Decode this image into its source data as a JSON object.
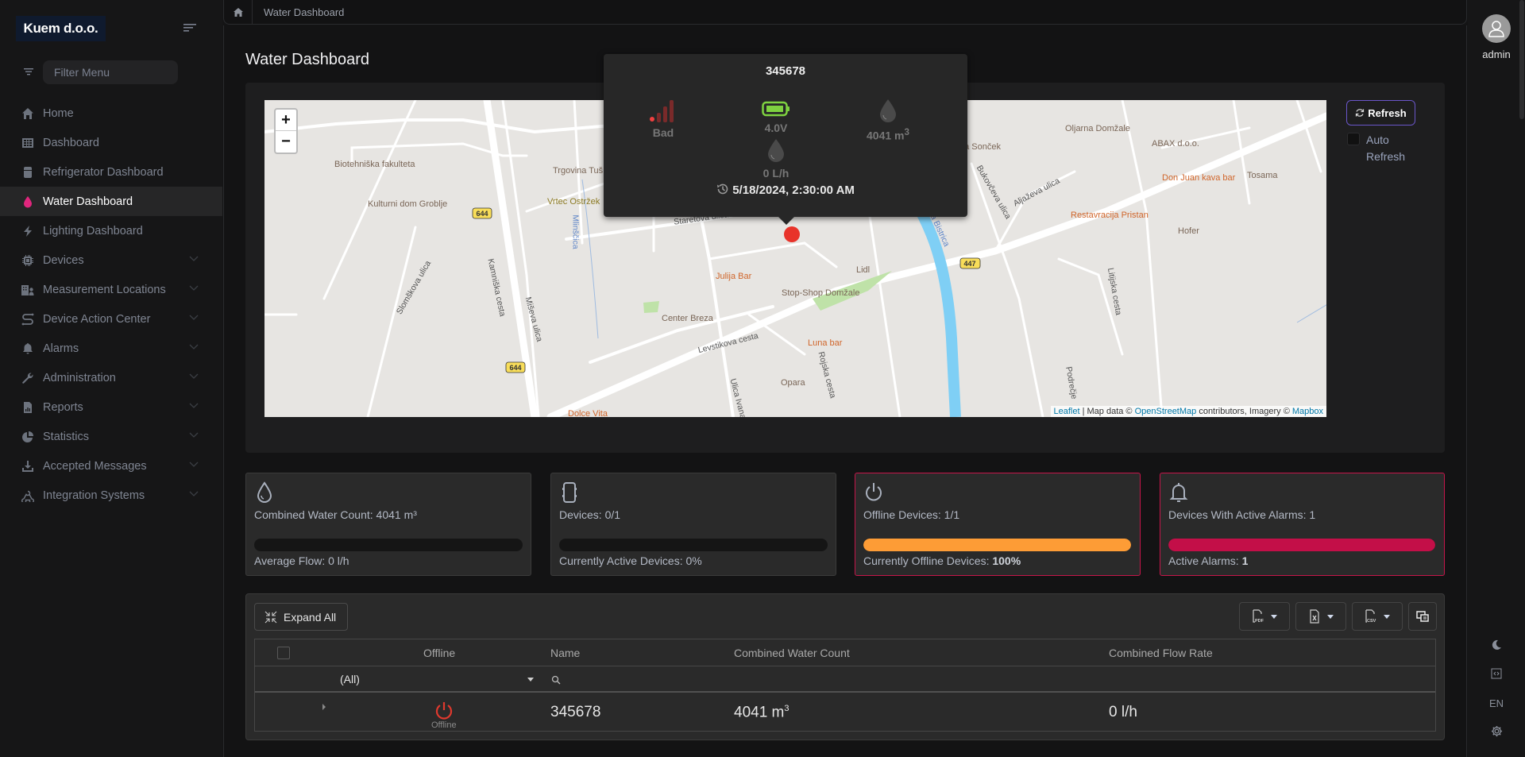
{
  "sidebar": {
    "brand": "Kuem d.o.o.",
    "filter_placeholder": "Filter Menu",
    "items": [
      {
        "label": "Home",
        "icon": "home-icon",
        "active": false,
        "expandable": false
      },
      {
        "label": "Dashboard",
        "icon": "grid-icon",
        "active": false,
        "expandable": false
      },
      {
        "label": "Refrigerator Dashboard",
        "icon": "refrigerator-icon",
        "active": false,
        "expandable": false
      },
      {
        "label": "Water Dashboard",
        "icon": "water-drop-icon",
        "active": true,
        "expandable": false
      },
      {
        "label": "Lighting Dashboard",
        "icon": "lightning-icon",
        "active": false,
        "expandable": false
      },
      {
        "label": "Devices",
        "icon": "chip-icon",
        "active": false,
        "expandable": true
      },
      {
        "label": "Measurement Locations",
        "icon": "building-user-icon",
        "active": false,
        "expandable": true
      },
      {
        "label": "Device Action Center",
        "icon": "route-icon",
        "active": false,
        "expandable": true
      },
      {
        "label": "Alarms",
        "icon": "bell-icon",
        "active": false,
        "expandable": true
      },
      {
        "label": "Administration",
        "icon": "wrench-icon",
        "active": false,
        "expandable": true
      },
      {
        "label": "Reports",
        "icon": "report-file-icon",
        "active": false,
        "expandable": true
      },
      {
        "label": "Statistics",
        "icon": "pie-chart-icon",
        "active": false,
        "expandable": true
      },
      {
        "label": "Accepted Messages",
        "icon": "download-tray-icon",
        "active": false,
        "expandable": true
      },
      {
        "label": "Integration Systems",
        "icon": "webhook-icon",
        "active": false,
        "expandable": true
      }
    ]
  },
  "breadcrumb": {
    "current": "Water Dashboard"
  },
  "page": {
    "title": "Water Dashboard"
  },
  "map": {
    "zoom_in": "+",
    "zoom_out": "−",
    "attribution": {
      "leaflet": "Leaflet",
      "sep": " | Map data © ",
      "osm": "OpenStreetMap",
      "mid": " contributors, Imagery © ",
      "mapbox": "Mapbox"
    },
    "labels": [
      {
        "text": "Biotehniška fakulteta",
        "kind": "poi"
      },
      {
        "text": "Kulturni dom Groblje",
        "kind": "poi"
      },
      {
        "text": "Trgovina Tuš",
        "kind": "poi"
      },
      {
        "text": "Vrtec Ostržek",
        "kind": "olive"
      },
      {
        "text": "Mlinščica",
        "kind": "water"
      },
      {
        "text": "Staretova ulica",
        "kind": "street"
      },
      {
        "text": "Julija Bar",
        "kind": "orange"
      },
      {
        "text": "Lidl",
        "kind": "poi"
      },
      {
        "text": "Stop-Shop Domžale",
        "kind": "poi"
      },
      {
        "text": "Center Breza",
        "kind": "poi"
      },
      {
        "text": "Luna bar",
        "kind": "orange"
      },
      {
        "text": "Levstikova cesta",
        "kind": "street"
      },
      {
        "text": "Opara",
        "kind": "poi"
      },
      {
        "text": "Dolce Vita",
        "kind": "orange"
      },
      {
        "text": "Kamniška cesta",
        "kind": "street"
      },
      {
        "text": "Miševa ulica",
        "kind": "street"
      },
      {
        "text": "Slomškova ulica",
        "kind": "street"
      },
      {
        "text": "Oljarna Domžale",
        "kind": "poi"
      },
      {
        "text": "ABAX d.o.o.",
        "kind": "poi"
      },
      {
        "text": "Don Juan kava bar",
        "kind": "orange"
      },
      {
        "text": "Tosama",
        "kind": "poi"
      },
      {
        "text": "Restavracija Pristan",
        "kind": "orange"
      },
      {
        "text": "Hofer",
        "kind": "poi"
      },
      {
        "text": "Aljaževa ulica",
        "kind": "street"
      },
      {
        "text": "Bukovčeva ulica",
        "kind": "street"
      },
      {
        "text": "Litijska cesta",
        "kind": "street"
      },
      {
        "text": "Rojska cesta",
        "kind": "street"
      },
      {
        "text": "Ulica Ivana",
        "kind": "street"
      },
      {
        "text": "Podrečje",
        "kind": "street"
      },
      {
        "text": "na Sonček",
        "kind": "poi"
      },
      {
        "text": "Kamniška Bistrica",
        "kind": "water"
      }
    ],
    "road_badges": [
      "644",
      "644",
      "447"
    ]
  },
  "popup": {
    "title": "345678",
    "signal_label": "Bad",
    "battery_label": "4.0V",
    "water_count": "4041 m",
    "water_count_sup": "3",
    "flow": "0 L/h",
    "timestamp": "5/18/2024, 2:30:00 AM"
  },
  "controls": {
    "refresh_label": "Refresh",
    "auto_refresh_label": "Auto Refresh",
    "auto_refresh_checked": false
  },
  "cards": [
    {
      "title": "Combined Water Count: 4041 m³",
      "sub_label": "Average Flow: ",
      "sub_value": "0 l/h",
      "progress_percent": 0,
      "color": "#151515",
      "icon": "water-drop-outline-icon",
      "alert": false
    },
    {
      "title": "Devices: 0/1",
      "sub_label": "Currently Active Devices: ",
      "sub_value": "0%",
      "progress_percent": 0,
      "color": "#151515",
      "icon": "device-icon",
      "alert": false
    },
    {
      "title": "Offline Devices: 1/1",
      "sub_label": "Currently Offline Devices: ",
      "sub_value": "100%",
      "progress_percent": 100,
      "color": "#fd9c36",
      "icon": "power-icon",
      "alert": true
    },
    {
      "title": "Devices With Active Alarms: 1",
      "sub_label": "Active Alarms: ",
      "sub_value": "1",
      "progress_percent": 100,
      "color": "#c30f48",
      "icon": "bell-outline-icon",
      "alert": true
    }
  ],
  "table": {
    "expand_all_label": "Expand All",
    "export_buttons": [
      "PDF",
      "XLSX",
      "CSV"
    ],
    "columns": [
      "Offline",
      "Name",
      "Combined Water Count",
      "Combined Flow Rate"
    ],
    "filter": {
      "offline_value": "(All)"
    },
    "rows": [
      {
        "offline_label": "Offline",
        "name": "345678",
        "water_count": "4041 m",
        "water_count_sup": "3",
        "flow_rate": "0 l/h"
      }
    ]
  },
  "user": {
    "name": "admin"
  },
  "rail": {
    "language": "EN"
  },
  "colors": {
    "accent": "#e0267d",
    "offline": "#fd9c36",
    "alarm": "#c30f48",
    "refresh_border": "#6a56c9",
    "marker": "#e8332a"
  }
}
